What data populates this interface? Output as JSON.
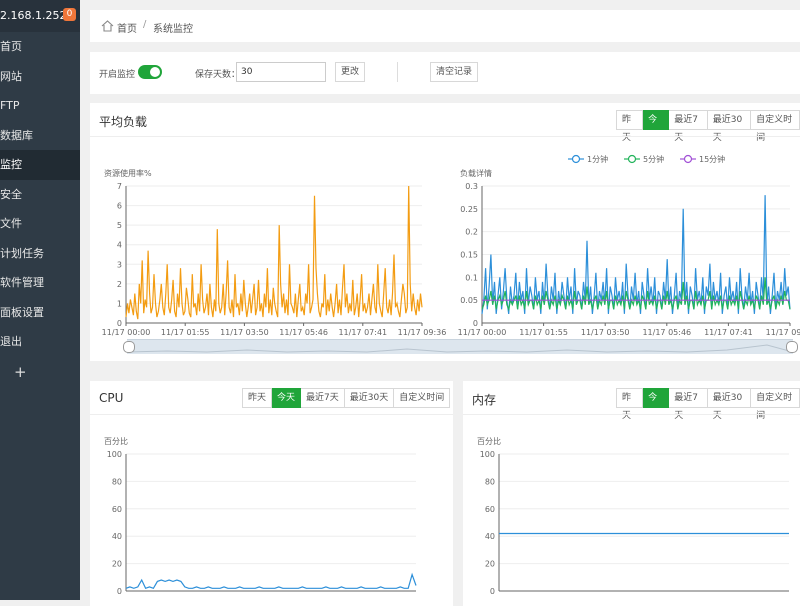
{
  "sidebar": {
    "ip": "2.168.1.252",
    "badge": "0",
    "items": [
      {
        "label": "首页",
        "active": false
      },
      {
        "label": "网站",
        "active": false
      },
      {
        "label": "FTP",
        "active": false
      },
      {
        "label": "数据库",
        "active": false
      },
      {
        "label": "监控",
        "active": true
      },
      {
        "label": "安全",
        "active": false
      },
      {
        "label": "文件",
        "active": false
      },
      {
        "label": "计划任务",
        "active": false
      },
      {
        "label": "软件管理",
        "active": false
      },
      {
        "label": "面板设置",
        "active": false
      },
      {
        "label": "退出",
        "active": false
      }
    ],
    "add": "+"
  },
  "breadcrumb": {
    "home": "首页",
    "separator": "/",
    "current": "系统监控"
  },
  "settings": {
    "monitor_label": "开启监控",
    "monitor_on": true,
    "days_label": "保存天数：",
    "days_value": "30",
    "change_button": "更改",
    "clear_button": "清空记录"
  },
  "ranges": [
    "昨天",
    "今天",
    "最近7天",
    "最近30天",
    "自定义时间"
  ],
  "range_selected": "今天",
  "load_panel": {
    "title": "平均负载"
  },
  "cpu_panel": {
    "title": "CPU"
  },
  "mem_panel": {
    "title": "内存"
  },
  "colors": {
    "accent": "#20a53a",
    "orange": "#f39c12",
    "blue": "#2c8fd9",
    "green": "#21b35a",
    "purple": "#a14fd6"
  },
  "chart_data": [
    {
      "type": "line",
      "name": "resource_usage",
      "title": "",
      "ylabel": "资源使用率%",
      "ylim": [
        0,
        7
      ],
      "yticks": [
        0,
        1,
        2,
        3,
        4,
        5,
        6,
        7
      ],
      "xticks": [
        "11/17 00:00",
        "11/17 01:55",
        "11/17 03:50",
        "11/17 05:46",
        "11/17 07:41",
        "11/17 09:36"
      ],
      "series": [
        {
          "color": "#f39c12",
          "values": [
            0.3,
            1,
            0.5,
            1.2,
            0.8,
            0.4,
            1.5,
            0.6,
            0.2,
            2,
            1,
            3.2,
            0.5,
            1.2,
            0.8,
            3.7,
            1.5,
            0.5,
            0.8,
            2.5,
            1,
            0.3,
            0.6,
            1.2,
            2,
            0.8,
            0.4,
            1.5,
            3,
            0.8,
            0.5,
            1.2,
            2.2,
            0.6,
            0.3,
            1.5,
            0.8,
            2.8,
            1,
            0.4,
            0.6,
            1.8,
            1.2,
            0.5,
            0.3,
            2.5,
            0.8,
            1,
            0.4,
            1.5,
            0.6,
            3,
            1.2,
            0.5,
            0.8,
            1.5,
            0.4,
            2,
            0.8,
            0.3,
            1.2,
            0.6,
            4.8,
            1,
            0.5,
            0.8,
            2,
            0.4,
            1.5,
            3.2,
            0.8,
            0.5,
            1.2,
            0.3,
            2.5,
            0.8,
            1,
            0.4,
            1.5,
            0.6,
            2.2,
            1,
            0.3,
            0.8,
            1.5,
            0.5,
            1.2,
            2,
            0.4,
            0.8,
            2.2,
            0.6,
            1,
            0.3,
            1.5,
            0.8,
            2.8,
            0.5,
            1.2,
            0.4,
            1.8,
            1,
            0.6,
            0.3,
            5,
            2,
            0.8,
            1.5,
            0.5,
            1.2,
            0.4,
            3,
            1,
            0.8,
            0.5,
            1.5,
            0.3,
            1.2,
            2,
            0.6,
            0.8,
            0.4,
            1.5,
            1,
            3,
            0.5,
            0.8,
            1.2,
            6.5,
            2.8,
            1.5,
            0.6,
            0.3,
            1,
            0.8,
            2.5,
            0.4,
            1.2,
            0.6,
            1.5,
            0.8,
            0.3,
            1,
            2,
            0.5,
            1.2,
            0.4,
            1.8,
            3,
            0.8,
            1.5,
            0.5,
            1,
            0.6,
            2.2,
            0.4,
            0.8,
            1.5,
            0.3,
            1.2,
            2.5,
            0.6,
            1,
            0.5,
            0.8,
            1.5,
            0.4,
            1.2,
            2,
            0.8,
            0.5,
            3,
            1,
            0.6,
            0.3,
            1.5,
            2.8,
            0.8,
            0.5,
            1.2,
            0.4,
            1.5,
            3.5,
            0.8,
            1,
            0.6,
            0.3,
            1.2,
            2,
            1.5,
            0.5,
            0.8,
            7,
            2,
            0.6,
            1.5,
            0.8,
            0.4,
            1.2,
            0.6,
            1.5,
            0.8
          ]
        }
      ]
    },
    {
      "type": "line",
      "name": "load_detail",
      "title": "",
      "ylabel": "负载详情",
      "ylim": [
        0,
        0.3
      ],
      "yticks": [
        0,
        0.05,
        0.1,
        0.15,
        0.2,
        0.25,
        0.3
      ],
      "xticks": [
        "11/17 00:00",
        "11/17 01:55",
        "11/17 03:50",
        "11/17 05:46",
        "11/17 07:41",
        "11/17 09:36"
      ],
      "legend": "top",
      "series": [
        {
          "name": "1分钟",
          "color": "#2c8fd9",
          "values": [
            0.02,
            0.05,
            0.12,
            0.03,
            0.08,
            0.15,
            0.04,
            0.09,
            0.02,
            0.06,
            0.1,
            0.03,
            0.07,
            0.12,
            0.05,
            0.02,
            0.08,
            0.04,
            0.06,
            0.11,
            0.03,
            0.09,
            0.05,
            0.07,
            0.02,
            0.12,
            0.04,
            0.08,
            0.06,
            0.03,
            0.1,
            0.05,
            0.07,
            0.02,
            0.09,
            0.04,
            0.13,
            0.06,
            0.03,
            0.08,
            0.05,
            0.11,
            0.02,
            0.07,
            0.04,
            0.09,
            0.06,
            0.03,
            0.1,
            0.05,
            0.08,
            0.02,
            0.12,
            0.04,
            0.07,
            0.06,
            0.03,
            0.09,
            0.05,
            0.18,
            0.04,
            0.08,
            0.02,
            0.06,
            0.11,
            0.03,
            0.07,
            0.05,
            0.09,
            0.04,
            0.12,
            0.02,
            0.08,
            0.06,
            0.03,
            0.1,
            0.05,
            0.07,
            0.04,
            0.09,
            0.02,
            0.13,
            0.06,
            0.03,
            0.08,
            0.05,
            0.11,
            0.04,
            0.07,
            0.02,
            0.09,
            0.06,
            0.03,
            0.12,
            0.05,
            0.08,
            0.04,
            0.1,
            0.02,
            0.07,
            0.06,
            0.03,
            0.09,
            0.05,
            0.14,
            0.04,
            0.08,
            0.02,
            0.06,
            0.11,
            0.03,
            0.07,
            0.05,
            0.25,
            0.04,
            0.09,
            0.02,
            0.08,
            0.06,
            0.03,
            0.12,
            0.05,
            0.07,
            0.04,
            0.1,
            0.02,
            0.08,
            0.06,
            0.13,
            0.03,
            0.09,
            0.05,
            0.07,
            0.04,
            0.11,
            0.02,
            0.06,
            0.08,
            0.03,
            0.1,
            0.05,
            0.07,
            0.04,
            0.09,
            0.02,
            0.12,
            0.06,
            0.03,
            0.08,
            0.05,
            0.11,
            0.04,
            0.07,
            0.02,
            0.09,
            0.06,
            0.03,
            0.1,
            0.05,
            0.28,
            0.04,
            0.08,
            0.02,
            0.06,
            0.11,
            0.03,
            0.07,
            0.05,
            0.09,
            0.04,
            0.12,
            0.06,
            0.08,
            0.03
          ]
        },
        {
          "name": "5分钟",
          "color": "#21b35a",
          "values": [
            0.03,
            0.04,
            0.06,
            0.04,
            0.05,
            0.07,
            0.04,
            0.06,
            0.03,
            0.05,
            0.06,
            0.04,
            0.05,
            0.07,
            0.04,
            0.03,
            0.05,
            0.04,
            0.05,
            0.06,
            0.03,
            0.06,
            0.04,
            0.05,
            0.03,
            0.07,
            0.04,
            0.05,
            0.05,
            0.03,
            0.06,
            0.04,
            0.05,
            0.03,
            0.06,
            0.04,
            0.07,
            0.05,
            0.03,
            0.05,
            0.04,
            0.06,
            0.03,
            0.05,
            0.04,
            0.06,
            0.05,
            0.03,
            0.06,
            0.04,
            0.05,
            0.03,
            0.07,
            0.04,
            0.05,
            0.05,
            0.03,
            0.06,
            0.04,
            0.08,
            0.04,
            0.05,
            0.03,
            0.05,
            0.06,
            0.03,
            0.05,
            0.04,
            0.06,
            0.04,
            0.07,
            0.03,
            0.05,
            0.05,
            0.03,
            0.06,
            0.04,
            0.05,
            0.04,
            0.06,
            0.03,
            0.07,
            0.05,
            0.03,
            0.05,
            0.04,
            0.06,
            0.04,
            0.05,
            0.03,
            0.06,
            0.05,
            0.03,
            0.07,
            0.04,
            0.05,
            0.04,
            0.06,
            0.03,
            0.05,
            0.05,
            0.03,
            0.06,
            0.04,
            0.07,
            0.04,
            0.05,
            0.03,
            0.05,
            0.06,
            0.03,
            0.05,
            0.04,
            0.09,
            0.04,
            0.06,
            0.03,
            0.05,
            0.05,
            0.03,
            0.07,
            0.04,
            0.05,
            0.04,
            0.06,
            0.03,
            0.05,
            0.05,
            0.07,
            0.03,
            0.06,
            0.04,
            0.05,
            0.04,
            0.06,
            0.03,
            0.05,
            0.05,
            0.03,
            0.06,
            0.04,
            0.05,
            0.04,
            0.06,
            0.03,
            0.07,
            0.05,
            0.03,
            0.05,
            0.04,
            0.06,
            0.04,
            0.05,
            0.03,
            0.06,
            0.05,
            0.03,
            0.06,
            0.04,
            0.1,
            0.04,
            0.05,
            0.03,
            0.05,
            0.06,
            0.03,
            0.05,
            0.04,
            0.06,
            0.04,
            0.07,
            0.05,
            0.05,
            0.03
          ]
        },
        {
          "name": "15分钟",
          "color": "#a14fd6",
          "values": [
            0.05,
            0.05,
            0.05,
            0.05,
            0.05,
            0.05,
            0.05,
            0.05,
            0.05,
            0.05,
            0.05,
            0.05,
            0.05,
            0.05,
            0.05,
            0.05,
            0.05,
            0.05,
            0.05,
            0.05,
            0.05,
            0.05,
            0.05,
            0.05,
            0.05,
            0.05,
            0.05,
            0.05,
            0.05,
            0.05,
            0.05,
            0.05,
            0.05,
            0.05,
            0.05,
            0.05,
            0.05,
            0.05,
            0.05,
            0.05
          ]
        }
      ]
    },
    {
      "type": "line",
      "name": "cpu",
      "title": "",
      "ylabel": "百分比",
      "ylim": [
        0,
        100
      ],
      "yticks": [
        0,
        20,
        40,
        60,
        80,
        100
      ],
      "series": [
        {
          "color": "#2c8fd9",
          "values": [
            2,
            3,
            2,
            3,
            8,
            2,
            3,
            2,
            7,
            8,
            7,
            8,
            7,
            8,
            7,
            3,
            2,
            2,
            3,
            2,
            2,
            3,
            2,
            2,
            2,
            3,
            2,
            2,
            2,
            3,
            2,
            2,
            2,
            2,
            3,
            2,
            2,
            2,
            2,
            3,
            2,
            2,
            2,
            2,
            2,
            3,
            2,
            2,
            2,
            2,
            2,
            3,
            2,
            2,
            2,
            3,
            2,
            2,
            2,
            2,
            3,
            2,
            2,
            2,
            2,
            3,
            2,
            2,
            2,
            2,
            3,
            2,
            2,
            12,
            4
          ]
        }
      ]
    },
    {
      "type": "line",
      "name": "memory",
      "title": "",
      "ylabel": "百分比",
      "ylim": [
        0,
        100
      ],
      "yticks": [
        0,
        20,
        40,
        60,
        80,
        100
      ],
      "series": [
        {
          "color": "#2c8fd9",
          "values": [
            42,
            42,
            42,
            42,
            42,
            42,
            42,
            42,
            42,
            42
          ]
        }
      ]
    }
  ]
}
